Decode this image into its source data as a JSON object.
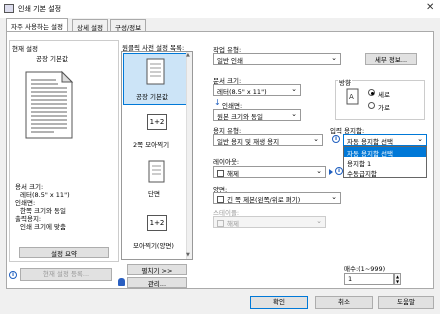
{
  "window": {
    "title": "인쇄 기본 설정",
    "close": "✕"
  },
  "tabs": [
    "자주 사용하는 설정",
    "상세 설정",
    "구성/정보"
  ],
  "current": {
    "heading": "현재 설정",
    "preset_name": "공장 기본값",
    "summary": [
      "용서 크기:",
      "레터(8.5\" x 11\")",
      "인쇄면:",
      "한쪽 크기와 동일",
      "출력용지:",
      "인쇄 크기에 맞춤"
    ],
    "summary_button": "설정 요약",
    "register_button": "현재 설정 등록..."
  },
  "presets": {
    "heading": "원클릭 사전 설정 목록:",
    "items": [
      "공장 기본값",
      "2쪽 모아찍기",
      "단면",
      "모아찍기(양면)"
    ],
    "items_icons": [
      "",
      "1+2",
      "",
      "1+2"
    ],
    "scroll_up": "▲",
    "scroll_down": "▼",
    "expand_button": "펼치기 >>",
    "manage_button": "관리..."
  },
  "output": {
    "job_type_label": "작업 유형:",
    "job_type_value": "일반 인쇄",
    "details_button": "세부 정보...",
    "doc_size_label": "문서 크기:",
    "doc_size_value": "레터(8.5\" x 11\")",
    "print_side_label": "인쇄면:",
    "print_side_value": "원본 크기와 동일",
    "orientation_label": "방향",
    "portrait": "세로",
    "landscape": "가로",
    "paper_type_label": "용지 유형:",
    "paper_type_value": "일반 용지 및 재생 용지",
    "input_tray_label": "입력 용지함:",
    "input_tray_value": "자동 용지함 선택",
    "input_tray_options": [
      "자동 용지함 선택",
      "용지함 1",
      "수동급지함"
    ],
    "layout_label": "레이아웃:",
    "layout_value": "해제",
    "duplex_label": "양면:",
    "duplex_value": "긴 쪽 제본(왼쪽/위로 펴기)",
    "staple_label": "스테이플:",
    "staple_value": "해제",
    "copies_label": "매수:(1~999)",
    "copies_value": "1"
  },
  "footer": {
    "ok": "확인",
    "cancel": "취소",
    "help": "도움말"
  }
}
